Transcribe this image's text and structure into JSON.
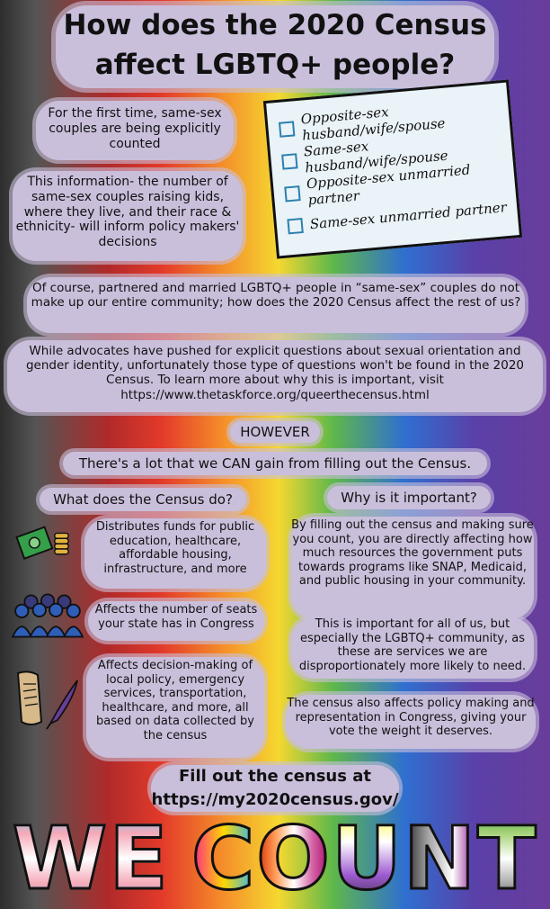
{
  "title": {
    "line1": "How does the 2020 Census",
    "line2": "affect LGBTQ+ people?"
  },
  "intro": {
    "first_time": "For the first time, same-sex couples are being explicitly counted",
    "information": "This information- the number of same-sex couples raising kids, where they live, and their race & ethnicity- will inform policy makers' decisions"
  },
  "census_form": {
    "options": [
      "Opposite-sex husband/wife/spouse",
      "Same-sex husband/wife/spouse",
      "Opposite-sex unmarried partner",
      "Same-sex unmarried partner"
    ]
  },
  "body": {
    "of_course": "Of course, partnered and married LGBTQ+ people in “same-sex” couples do not make up our entire community; how does the 2020 Census affect the rest of us?",
    "advocates": "While advocates have pushed for explicit questions about sexual orientation and gender identity, unfortunately those type of questions won't be found in the 2020 Census. To learn more about why this is important, visit https://www.thetaskforce.org/queerthecensus.html",
    "however": "HOWEVER",
    "gain": "There's a lot that we CAN gain from filling out the Census."
  },
  "what_it_does": {
    "heading": "What does the Census do?",
    "items": [
      {
        "icon": "money-icon",
        "text": "Distributes funds for public education, healthcare, affordable housing, infrastructure, and more"
      },
      {
        "icon": "people-icon",
        "text": "Affects the number of seats your state has in Congress"
      },
      {
        "icon": "scroll-quill-icon",
        "text": "Affects decision-making of local policy, emergency services, transportation, healthcare, and more, all based on data collected by the census"
      }
    ]
  },
  "why_important": {
    "heading": "Why is it important?",
    "para1": "By filling out the census and making sure you count, you are directly affecting how much resources the government puts towards programs like SNAP, Medicaid, and public housing in your community.",
    "para2": "This is important for all of us, but especially the LGBTQ+ community, as these are services we are disproportionately more likely to need.",
    "para3": "The census also affects policy making and representation in Congress, giving your vote the weight it deserves."
  },
  "cta": {
    "line1": "Fill out the census at",
    "line2": "https://my2020census.gov/"
  },
  "footer": {
    "letters": [
      "W",
      "E",
      "C",
      "O",
      "U",
      "N",
      "T"
    ]
  }
}
